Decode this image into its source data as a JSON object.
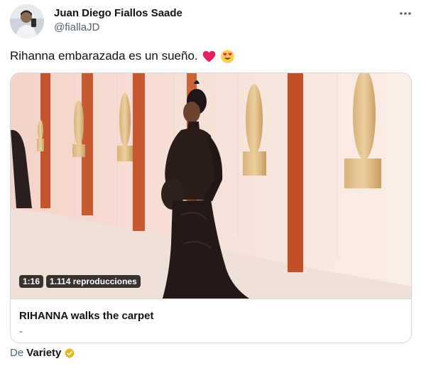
{
  "author": {
    "name": "Juan Diego Fiallos Saade",
    "handle": "@fiallaJD",
    "avatar_icon": "avatar-photo"
  },
  "menu": {
    "icon": "more-horizontal-icon"
  },
  "tweet": {
    "text": "Rihanna embarazada es un sueño.",
    "emojis": [
      "red-heart-emoji",
      "heart-eyes-emoji"
    ]
  },
  "media_card": {
    "duration": "1:16",
    "views": "1.114 reproducciones",
    "title": "RIHANNA walks the carpet",
    "description": "-"
  },
  "source": {
    "prefix": "De",
    "name": "Variety",
    "badge_icon": "gold-verified-icon"
  },
  "colors": {
    "text_primary": "#0f1419",
    "text_secondary": "#536471",
    "border": "#cfd9de",
    "heart": "#e0245e",
    "verified_gold": "#e2b719"
  }
}
